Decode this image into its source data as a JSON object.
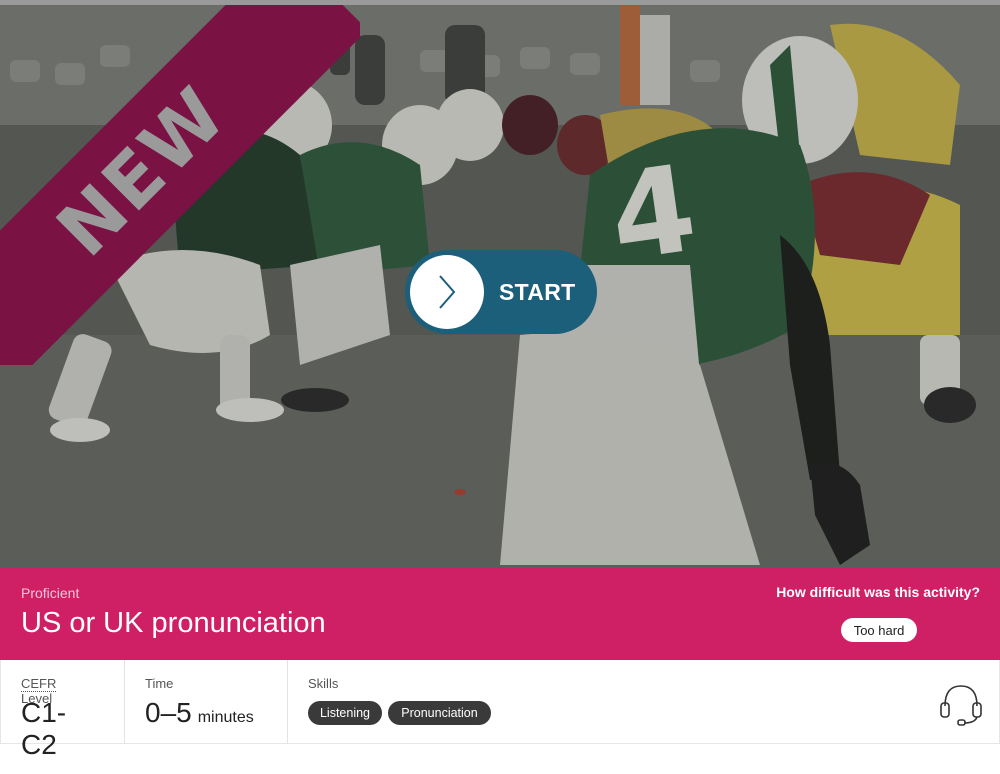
{
  "badge": {
    "label": "NEW"
  },
  "start_button": {
    "label": "START"
  },
  "activity": {
    "level_name": "Proficient",
    "title": "US or UK pronunciation",
    "feedback_question": "How difficult was this activity?",
    "feedback_button": "Too hard"
  },
  "info": {
    "cefr": {
      "abbr": "CEFR",
      "label": " Level",
      "value": "C1-C2"
    },
    "time": {
      "label": "Time",
      "value": "0–5",
      "unit": "minutes"
    },
    "skills": {
      "label": "Skills",
      "items": [
        "Listening",
        "Pronunciation"
      ]
    }
  },
  "icons": {
    "play": "chevron-right-icon",
    "skill": "headset-icon"
  },
  "colors": {
    "band": "#cf1f65",
    "ribbon": "#7b1244",
    "start_button": "#1c5f7b",
    "chip": "#3a3a3a"
  }
}
